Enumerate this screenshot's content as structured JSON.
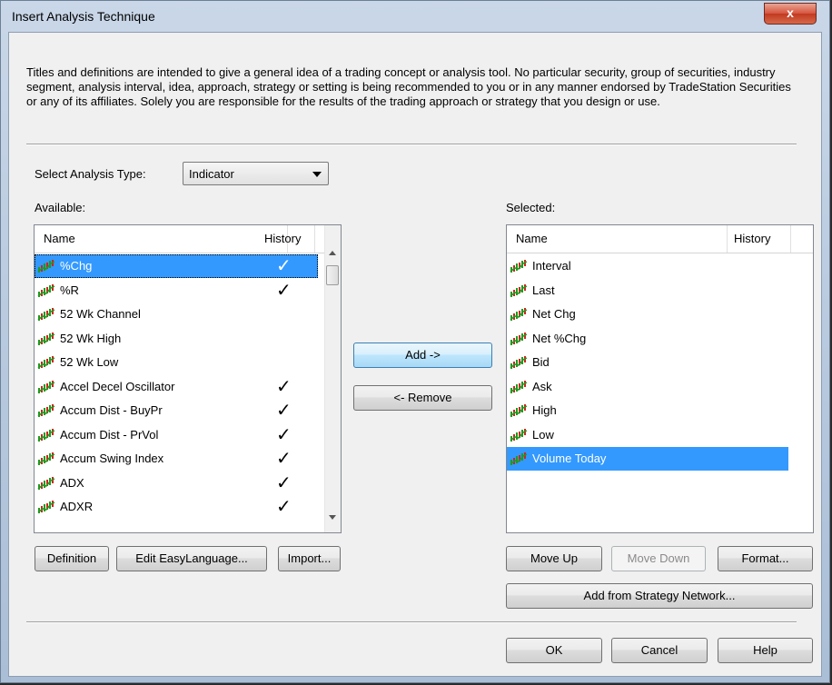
{
  "window": {
    "title": "Insert Analysis Technique",
    "close_label": "x"
  },
  "disclaimer": "Titles and definitions are intended to give a general idea of a trading concept or analysis tool. No particular security, group of securities, industry segment, analysis interval, idea, approach, strategy or setting is being recommended to you or in any manner endorsed by TradeStation Securities or any of its affiliates. Solely you are responsible for the results of the trading approach or strategy that you design or use.",
  "analysis_type": {
    "label": "Select Analysis Type:",
    "value": "Indicator"
  },
  "available": {
    "label": "Available:",
    "columns": {
      "name": "Name",
      "history": "History"
    },
    "items": [
      {
        "name": "%Chg",
        "history": "✓",
        "selected": true
      },
      {
        "name": "%R",
        "history": "✓"
      },
      {
        "name": "52 Wk Channel",
        "history": ""
      },
      {
        "name": "52 Wk High",
        "history": ""
      },
      {
        "name": "52 Wk Low",
        "history": ""
      },
      {
        "name": "Accel Decel Oscillator",
        "history": "✓"
      },
      {
        "name": "Accum Dist - BuyPr",
        "history": "✓"
      },
      {
        "name": "Accum Dist - PrVol",
        "history": "✓"
      },
      {
        "name": "Accum Swing Index",
        "history": "✓"
      },
      {
        "name": "ADX",
        "history": "✓"
      },
      {
        "name": "ADXR",
        "history": "✓"
      }
    ]
  },
  "selected_list": {
    "label": "Selected:",
    "columns": {
      "name": "Name",
      "history": "History"
    },
    "items": [
      {
        "name": "Interval"
      },
      {
        "name": "Last"
      },
      {
        "name": "Net Chg"
      },
      {
        "name": "Net %Chg"
      },
      {
        "name": "Bid"
      },
      {
        "name": "Ask"
      },
      {
        "name": "High"
      },
      {
        "name": "Low"
      },
      {
        "name": "Volume Today",
        "selected": true
      }
    ]
  },
  "buttons": {
    "add": "Add ->",
    "remove": "<- Remove",
    "definition": "Definition",
    "edit_easylanguage": "Edit EasyLanguage...",
    "import": "Import...",
    "move_up": "Move Up",
    "move_down": "Move Down",
    "format": "Format...",
    "add_from_strategy_network": "Add from Strategy Network...",
    "ok": "OK",
    "cancel": "Cancel",
    "help": "Help"
  },
  "colors": {
    "selection": "#3399ff",
    "icon_green": "#1f9a1f",
    "icon_red": "#d42020"
  }
}
